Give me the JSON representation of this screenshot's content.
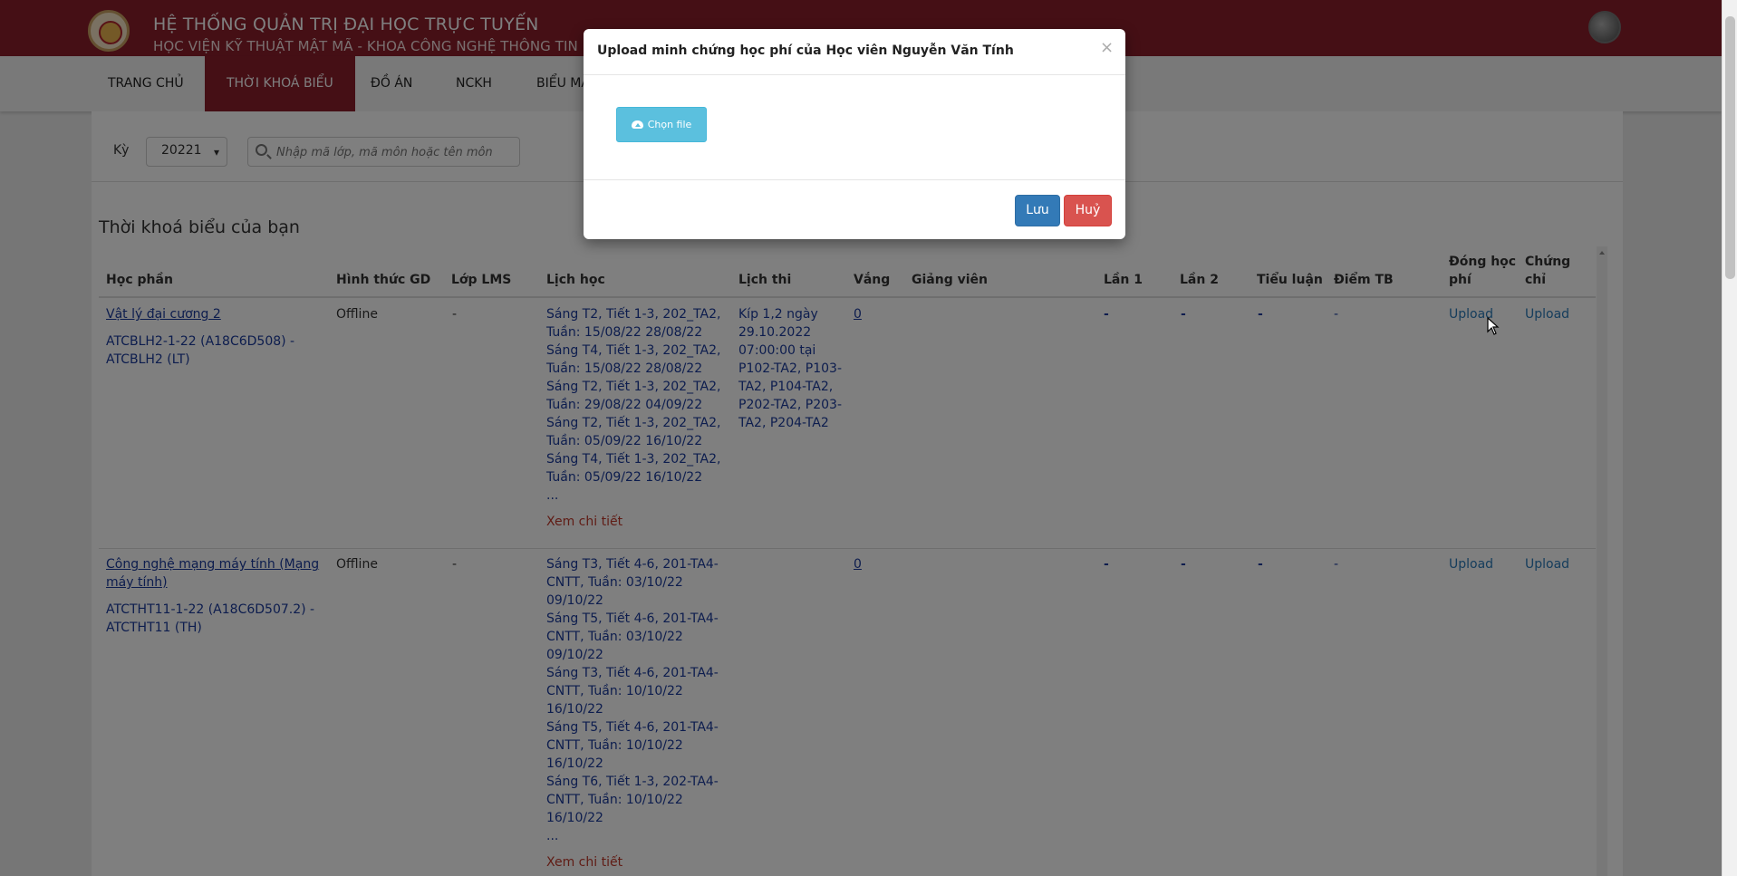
{
  "header": {
    "title": "HỆ THỐNG QUẢN TRỊ ĐẠI HỌC TRỰC TUYẾN",
    "subtitle": "HỌC VIỆN KỸ THUẬT MẬT MÃ - KHOA CÔNG NGHỆ THÔNG TIN"
  },
  "nav": {
    "items": [
      "TRANG CHỦ",
      "THỜI KHOÁ BIỂU",
      "ĐỒ ÁN",
      "NCKH",
      "BIỂU MẪU"
    ],
    "active": "THỜI KHOÁ BIỂU"
  },
  "filter": {
    "term_label": "Kỳ",
    "term_value": "20221",
    "search_placeholder": "Nhập mã lớp, mã môn hoặc tên môn"
  },
  "section_title": "Thời khoá biểu của bạn",
  "table": {
    "headers": {
      "course": "Học phần",
      "mode": "Hình thức GD",
      "lms": "Lớp LMS",
      "schedule": "Lịch học",
      "exam": "Lịch thi",
      "absent": "Vắng",
      "lecturer": "Giảng viên",
      "round1": "Lần 1",
      "round2": "Lần 2",
      "essay": "Tiểu luận",
      "avg": "Điểm TB",
      "fee_line1": "Đóng học",
      "fee_line2": "phí",
      "cert_line1": "Chứng",
      "cert_line2": "chỉ"
    },
    "rows": [
      {
        "course_name": "Vật lý đại cương 2",
        "course_code_l1": "ATCBLH2-1-22 (A18C6D508) -",
        "course_code_l2": "ATCBLH2 (LT)",
        "mode": "Offline",
        "lms": "-",
        "schedule": [
          "Sáng T2, Tiết 1-3, 202_TA2,",
          "Tuần: 15/08/22 28/08/22",
          "Sáng T4, Tiết 1-3, 202_TA2,",
          "Tuần: 15/08/22 28/08/22",
          "Sáng T2, Tiết 1-3, 202_TA2,",
          "Tuần: 29/08/22 04/09/22",
          "Sáng T2, Tiết 1-3, 202_TA2,",
          "Tuần: 05/09/22 16/10/22",
          "Sáng T4, Tiết 1-3, 202_TA2,",
          "Tuần: 05/09/22 16/10/22",
          "..."
        ],
        "detail_link": "Xem chi tiết",
        "exam": [
          "Kíp 1,2 ngày",
          "29.10.2022",
          "07:00:00 tại",
          "P102-TA2, P103-",
          "TA2, P104-TA2,",
          "P202-TA2, P203-",
          "TA2, P204-TA2"
        ],
        "absent": "0",
        "round1": "-",
        "round2": "-",
        "essay": "-",
        "avg": "-",
        "fee": "Upload",
        "cert": "Upload"
      },
      {
        "course_name_l1": "Công nghệ mạng máy tính (Mạng",
        "course_name_l2": "máy tính)",
        "course_code_l1": "ATCTHT11-1-22 (A18C6D507.2) -",
        "course_code_l2": "ATCTHT11 (TH)",
        "mode": "Offline",
        "lms": "-",
        "schedule": [
          "Sáng T3, Tiết 4-6, 201-TA4-",
          "CNTT, Tuần: 03/10/22",
          "09/10/22",
          "Sáng T5, Tiết 4-6, 201-TA4-",
          "CNTT, Tuần: 03/10/22",
          "09/10/22",
          "Sáng T3, Tiết 4-6, 201-TA4-",
          "CNTT, Tuần: 10/10/22",
          "16/10/22",
          "Sáng T5, Tiết 4-6, 201-TA4-",
          "CNTT, Tuần: 10/10/22",
          "16/10/22",
          "Sáng T6, Tiết 1-3, 202-TA4-",
          "CNTT, Tuần: 10/10/22",
          "16/10/22",
          "..."
        ],
        "detail_link": "Xem chi tiết",
        "absent": "0",
        "round1": "-",
        "round2": "-",
        "essay": "-",
        "avg": "-",
        "fee": "Upload",
        "cert": "Upload"
      }
    ]
  },
  "modal": {
    "title": "Upload minh chứng học phí của Học viên Nguyễn Văn Tính",
    "close": "×",
    "choose_file": "Chọn file",
    "save": "Lưu",
    "cancel": "Huỷ"
  },
  "colors": {
    "brand": "#8b1e2b",
    "primary": "#337ab7",
    "danger": "#d9534f",
    "info": "#5bc0de"
  }
}
